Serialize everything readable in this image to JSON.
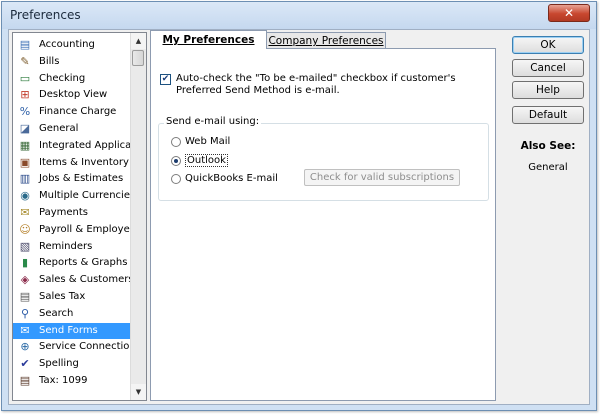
{
  "window": {
    "title": "Preferences",
    "close_symbol": "✕"
  },
  "sidebar": {
    "items": [
      {
        "label": "Accounting",
        "icon": "accounting-icon",
        "glyph": "▤",
        "color": "#3a6fb5"
      },
      {
        "label": "Bills",
        "icon": "bills-icon",
        "glyph": "✎",
        "color": "#7a5a2a"
      },
      {
        "label": "Checking",
        "icon": "checking-icon",
        "glyph": "▭",
        "color": "#2a7a3a"
      },
      {
        "label": "Desktop View",
        "icon": "desktop-view-icon",
        "glyph": "⊞",
        "color": "#c23a2a"
      },
      {
        "label": "Finance Charge",
        "icon": "finance-charge-icon",
        "glyph": "%",
        "color": "#2b5da6"
      },
      {
        "label": "General",
        "icon": "general-icon",
        "glyph": "◪",
        "color": "#4a6a9a"
      },
      {
        "label": "Integrated Applicatio",
        "icon": "integrated-applications-icon",
        "glyph": "▦",
        "color": "#3a6a3a"
      },
      {
        "label": "Items & Inventory",
        "icon": "items-inventory-icon",
        "glyph": "▣",
        "color": "#8a4a2a"
      },
      {
        "label": "Jobs & Estimates",
        "icon": "jobs-estimates-icon",
        "glyph": "▥",
        "color": "#2a4a8a"
      },
      {
        "label": "Multiple Currencies",
        "icon": "multiple-currencies-icon",
        "glyph": "◉",
        "color": "#2a6a8a"
      },
      {
        "label": "Payments",
        "icon": "payments-icon",
        "glyph": "✉",
        "color": "#a68a2a"
      },
      {
        "label": "Payroll & Employees",
        "icon": "payroll-employees-icon",
        "glyph": "☺",
        "color": "#b5802a"
      },
      {
        "label": "Reminders",
        "icon": "reminders-icon",
        "glyph": "▧",
        "color": "#4a4a6a"
      },
      {
        "label": "Reports & Graphs",
        "icon": "reports-graphs-icon",
        "glyph": "▮",
        "color": "#2a8a4a"
      },
      {
        "label": "Sales & Customers",
        "icon": "sales-customers-icon",
        "glyph": "◈",
        "color": "#8a2a4a"
      },
      {
        "label": "Sales Tax",
        "icon": "sales-tax-icon",
        "glyph": "▤",
        "color": "#5a5a5a"
      },
      {
        "label": "Search",
        "icon": "search-icon",
        "glyph": "⚲",
        "color": "#2a5aa6"
      },
      {
        "label": "Send Forms",
        "icon": "send-forms-icon",
        "glyph": "✉",
        "color": "#ffffff",
        "selected": true
      },
      {
        "label": "Service Connection",
        "icon": "service-connection-icon",
        "glyph": "⊕",
        "color": "#2a6aa6"
      },
      {
        "label": "Spelling",
        "icon": "spelling-icon",
        "glyph": "✔",
        "color": "#2a3a9a"
      },
      {
        "label": "Tax: 1099",
        "icon": "tax-1099-icon",
        "glyph": "▤",
        "color": "#5a3a2a"
      }
    ],
    "scroll_up": "▲",
    "scroll_down": "▼"
  },
  "tabs": {
    "my_preferences": "My Preferences",
    "company_preferences": "Company Preferences"
  },
  "panel": {
    "auto_check_line1": "Auto-check the \"To be e-mailed\" checkbox if customer's",
    "auto_check_line2": "Preferred Send Method is e-mail.",
    "auto_check_checked": true,
    "check_mark": "✔",
    "send_email_title": "Send e-mail using:",
    "options": [
      {
        "label": "Web Mail",
        "selected": false
      },
      {
        "label": "Outlook",
        "selected": true
      },
      {
        "label": "QuickBooks E-mail",
        "selected": false
      }
    ],
    "check_subscriptions": "Check for valid subscriptions"
  },
  "buttons": {
    "ok": "OK",
    "cancel": "Cancel",
    "help": "Help",
    "default": "Default"
  },
  "also_see": {
    "title": "Also See:",
    "link": "General"
  }
}
